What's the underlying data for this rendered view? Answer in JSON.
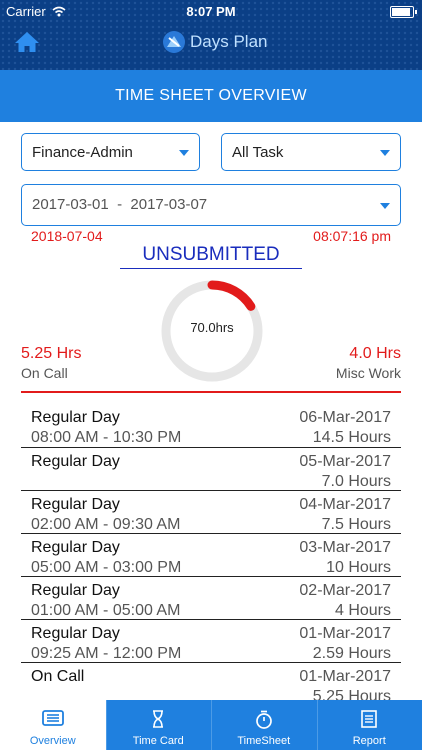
{
  "status_bar": {
    "carrier": "Carrier",
    "time": "8:07 PM"
  },
  "header": {
    "logo_text": "Days Plan",
    "title": "TIME SHEET OVERVIEW"
  },
  "filters": {
    "department": "Finance-Admin",
    "task": "All Task",
    "date_range": "2017-03-01  -  2017-03-07"
  },
  "current": {
    "date": "2018-07-04",
    "time": "08:07:16 pm"
  },
  "sheet_status": "UNSUBMITTED",
  "gauge": {
    "label": "70.0hrs",
    "fraction": 0.16,
    "color": "#e21b1b"
  },
  "summary": {
    "left_value": "5.25 Hrs",
    "left_label": "On Call",
    "right_value": "4.0 Hrs",
    "right_label": "Misc Work"
  },
  "entries": [
    {
      "day": "Regular Day",
      "date": "06-Mar-2017",
      "range": "08:00 AM - 10:30 PM",
      "hours": "14.5 Hours"
    },
    {
      "day": "Regular Day",
      "date": "05-Mar-2017",
      "range": "",
      "hours": "7.0 Hours"
    },
    {
      "day": "Regular Day",
      "date": "04-Mar-2017",
      "range": "02:00 AM - 09:30 AM",
      "hours": "7.5 Hours"
    },
    {
      "day": "Regular Day",
      "date": "03-Mar-2017",
      "range": "05:00 AM - 03:00 PM",
      "hours": "10 Hours"
    },
    {
      "day": "Regular Day",
      "date": "02-Mar-2017",
      "range": "01:00 AM - 05:00 AM",
      "hours": "4 Hours"
    },
    {
      "day": "Regular Day",
      "date": "01-Mar-2017",
      "range": "09:25 AM - 12:00 PM",
      "hours": "2.59 Hours"
    },
    {
      "day": "On Call",
      "date": "01-Mar-2017",
      "range": "",
      "hours": "5.25 Hours"
    }
  ],
  "tabs": [
    {
      "label": "Overview",
      "icon": "overview-icon"
    },
    {
      "label": "Time Card",
      "icon": "hourglass-icon"
    },
    {
      "label": "TimeSheet",
      "icon": "stopwatch-icon"
    },
    {
      "label": "Report",
      "icon": "report-icon"
    }
  ],
  "colors": {
    "header_dark": "#0b3f86",
    "accent_blue": "#1f80df",
    "alert_red": "#e21b1b",
    "status_blue": "#1a2dbd"
  }
}
